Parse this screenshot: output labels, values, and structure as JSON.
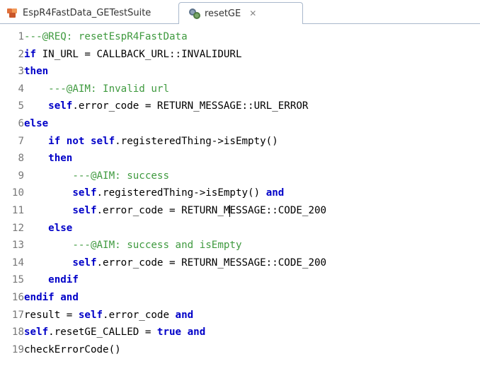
{
  "tabs": [
    {
      "label": "EspR4FastData_GETestSuite",
      "icon": "project-icon",
      "active": false
    },
    {
      "label": "resetGE",
      "icon": "gears-icon",
      "active": true,
      "close": "✕"
    }
  ],
  "colors": {
    "keyword": "#0000c8",
    "comment": "#3f9a3f",
    "line_number": "#787878",
    "text": "#000000"
  },
  "lines": [
    {
      "num": "1",
      "indent": "",
      "segs": [
        {
          "t": "---@REQ: resetEspR4FastData",
          "c": "cm"
        }
      ]
    },
    {
      "num": "2",
      "indent": "",
      "segs": [
        {
          "t": "if",
          "c": "kw"
        },
        {
          "t": " IN_URL = CALLBACK_URL::INVALIDURL",
          "c": ""
        }
      ]
    },
    {
      "num": "3",
      "indent": "",
      "segs": [
        {
          "t": "then",
          "c": "kw"
        }
      ]
    },
    {
      "num": "4",
      "indent": "    ",
      "segs": [
        {
          "t": "---@AIM: Invalid url",
          "c": "cm"
        }
      ]
    },
    {
      "num": "5",
      "indent": "    ",
      "segs": [
        {
          "t": "self",
          "c": "kw"
        },
        {
          "t": ".error_code = RETURN_MESSAGE::URL_ERROR",
          "c": ""
        }
      ]
    },
    {
      "num": "6",
      "indent": "",
      "segs": [
        {
          "t": "else",
          "c": "kw"
        }
      ]
    },
    {
      "num": "7",
      "indent": "    ",
      "segs": [
        {
          "t": "if not self",
          "c": "kw"
        },
        {
          "t": ".registeredThing->isEmpty()",
          "c": ""
        }
      ]
    },
    {
      "num": "8",
      "indent": "    ",
      "segs": [
        {
          "t": "then",
          "c": "kw"
        }
      ]
    },
    {
      "num": "9",
      "indent": "        ",
      "segs": [
        {
          "t": "---@AIM: success",
          "c": "cm"
        }
      ]
    },
    {
      "num": "10",
      "indent": "        ",
      "segs": [
        {
          "t": "self",
          "c": "kw"
        },
        {
          "t": ".registeredThing->isEmpty() ",
          "c": ""
        },
        {
          "t": "and",
          "c": "kw"
        }
      ]
    },
    {
      "num": "11",
      "indent": "        ",
      "segs": [
        {
          "t": "self",
          "c": "kw"
        },
        {
          "t": ".error_code = RETURN_M",
          "c": ""
        },
        {
          "t": "",
          "c": "caret"
        },
        {
          "t": "ESSAGE::CODE_200",
          "c": ""
        }
      ]
    },
    {
      "num": "12",
      "indent": "    ",
      "segs": [
        {
          "t": "else",
          "c": "kw"
        }
      ]
    },
    {
      "num": "13",
      "indent": "        ",
      "segs": [
        {
          "t": "---@AIM: success and isEmpty",
          "c": "cm"
        }
      ]
    },
    {
      "num": "14",
      "indent": "        ",
      "segs": [
        {
          "t": "self",
          "c": "kw"
        },
        {
          "t": ".error_code = RETURN_MESSAGE::CODE_200",
          "c": ""
        }
      ]
    },
    {
      "num": "15",
      "indent": "    ",
      "segs": [
        {
          "t": "endif",
          "c": "kw"
        }
      ]
    },
    {
      "num": "16",
      "indent": "",
      "segs": [
        {
          "t": "endif and",
          "c": "kw"
        }
      ]
    },
    {
      "num": "17",
      "indent": "",
      "segs": [
        {
          "t": "result = ",
          "c": ""
        },
        {
          "t": "self",
          "c": "kw"
        },
        {
          "t": ".error_code ",
          "c": ""
        },
        {
          "t": "and",
          "c": "kw"
        }
      ]
    },
    {
      "num": "18",
      "indent": "",
      "segs": [
        {
          "t": "self",
          "c": "kw"
        },
        {
          "t": ".resetGE_CALLED = ",
          "c": ""
        },
        {
          "t": "true and",
          "c": "kw"
        }
      ]
    },
    {
      "num": "19",
      "indent": "",
      "segs": [
        {
          "t": "checkErrorCode()",
          "c": ""
        }
      ]
    }
  ]
}
